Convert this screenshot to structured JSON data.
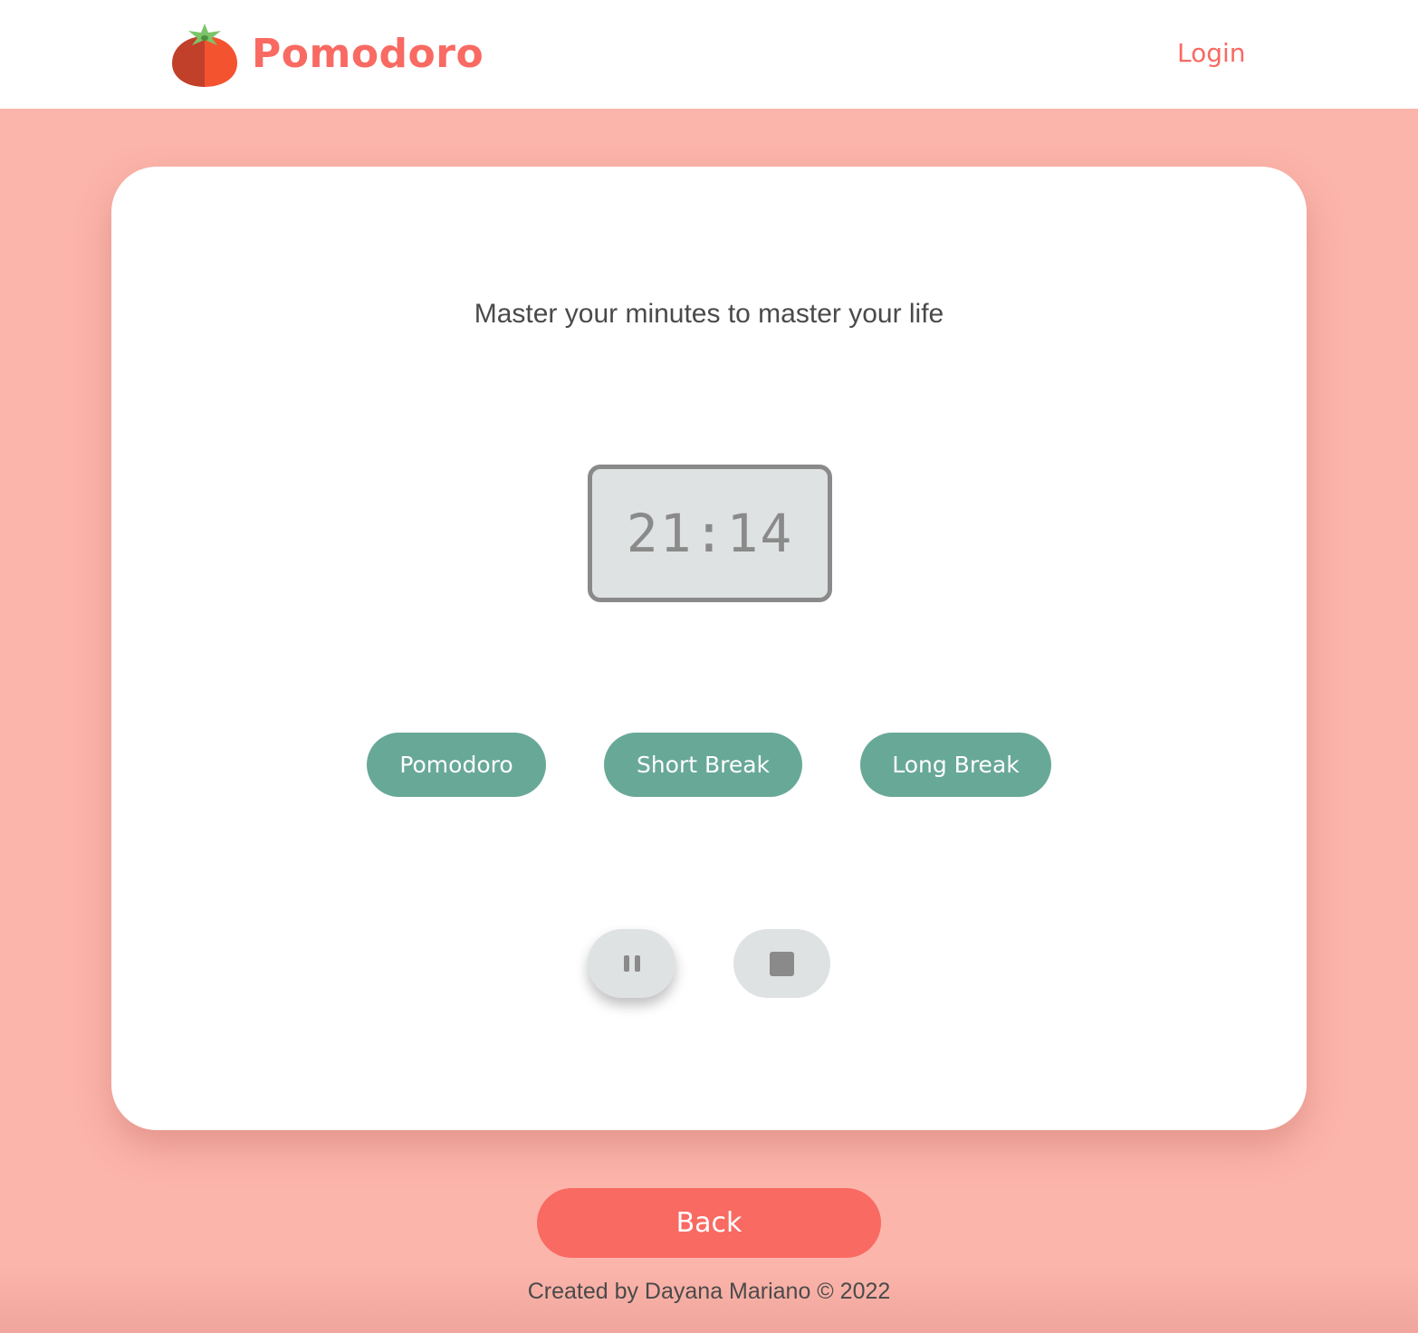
{
  "header": {
    "brand_name": "Pomodoro",
    "logo_icon": "tomato-icon",
    "login_label": "Login"
  },
  "main": {
    "tagline": "Master your minutes to master your life",
    "timer": "21:14",
    "modes": [
      {
        "label": "Pomodoro"
      },
      {
        "label": "Short Break"
      },
      {
        "label": "Long Break"
      }
    ],
    "controls": {
      "pause_icon": "pause-icon",
      "stop_icon": "stop-icon"
    }
  },
  "back_label": "Back",
  "footer_text": "Created by Dayana Mariano © 2022",
  "colors": {
    "background": "#FCB5AB",
    "accent": "#F86A62",
    "mode_button": "#68A897",
    "timer_bg": "#DFE2E3",
    "timer_text": "#8a8a8a"
  }
}
